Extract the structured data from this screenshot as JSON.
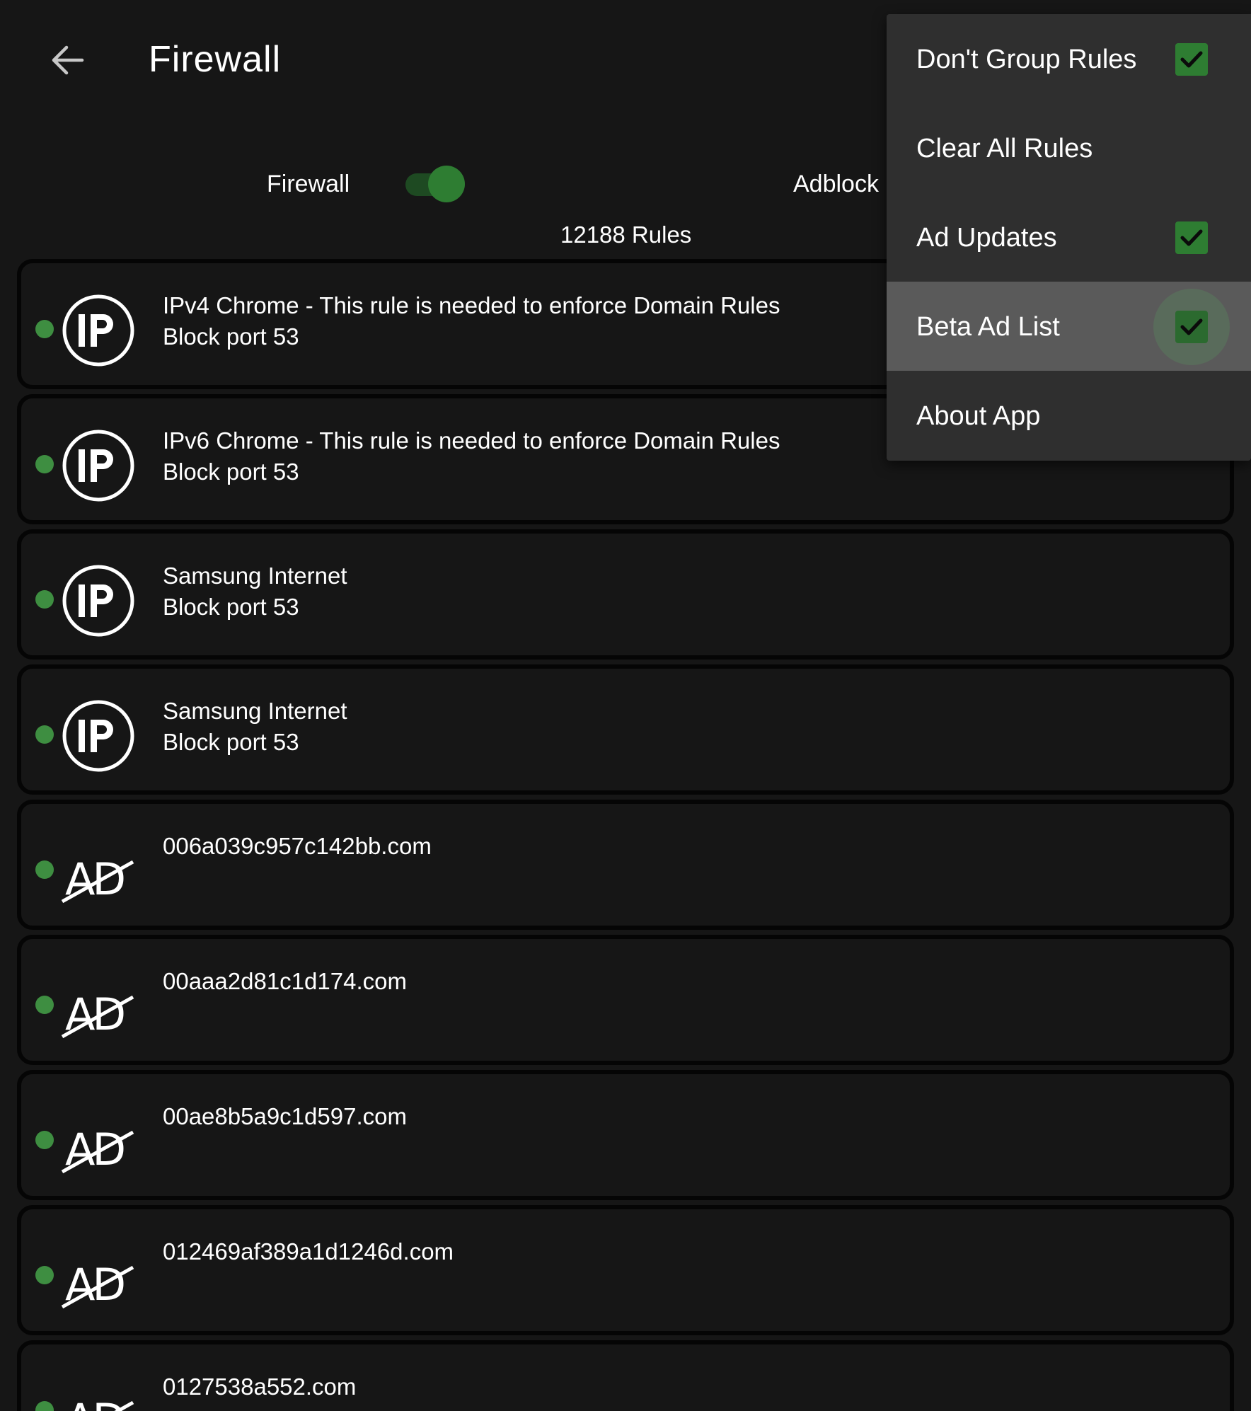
{
  "header": {
    "title": "Firewall",
    "back_icon": "arrow-left-icon"
  },
  "toggles": {
    "firewall_label": "Firewall",
    "firewall_on": true,
    "adblock_label": "Adblock"
  },
  "rules_count": "12188 Rules",
  "colors": {
    "accent": "#2e7d32",
    "status_dot": "#3e8e41",
    "background": "#161616",
    "menu_bg": "#2f2f2f",
    "menu_highlight": "#5a5a5a"
  },
  "rules": [
    {
      "icon": "ip-icon",
      "line1": "IPv4 Chrome - This rule is needed to enforce Domain Rules",
      "line2": "Block port 53"
    },
    {
      "icon": "ip-icon",
      "line1": "IPv6 Chrome - This rule is needed to enforce Domain Rules",
      "line2": "Block port 53"
    },
    {
      "icon": "ip-icon",
      "line1": "Samsung Internet",
      "line2": "Block port 53"
    },
    {
      "icon": "ip-icon",
      "line1": "Samsung Internet",
      "line2": "Block port 53"
    },
    {
      "icon": "ad-block-icon",
      "line1": "006a039c957c142bb.com",
      "line2": ""
    },
    {
      "icon": "ad-block-icon",
      "line1": "00aaa2d81c1d174.com",
      "line2": ""
    },
    {
      "icon": "ad-block-icon",
      "line1": "00ae8b5a9c1d597.com",
      "line2": ""
    },
    {
      "icon": "ad-block-icon",
      "line1": "012469af389a1d1246d.com",
      "line2": ""
    },
    {
      "icon": "ad-block-icon",
      "line1": "0127538a552.com",
      "line2": ""
    }
  ],
  "menu": {
    "items": [
      {
        "label": "Don't Group Rules",
        "checkable": true,
        "checked": true
      },
      {
        "label": "Clear All Rules",
        "checkable": false
      },
      {
        "label": "Ad Updates",
        "checkable": true,
        "checked": true
      },
      {
        "label": "Beta Ad List",
        "checkable": true,
        "checked": true
      },
      {
        "label": "About App",
        "checkable": false
      }
    ]
  }
}
